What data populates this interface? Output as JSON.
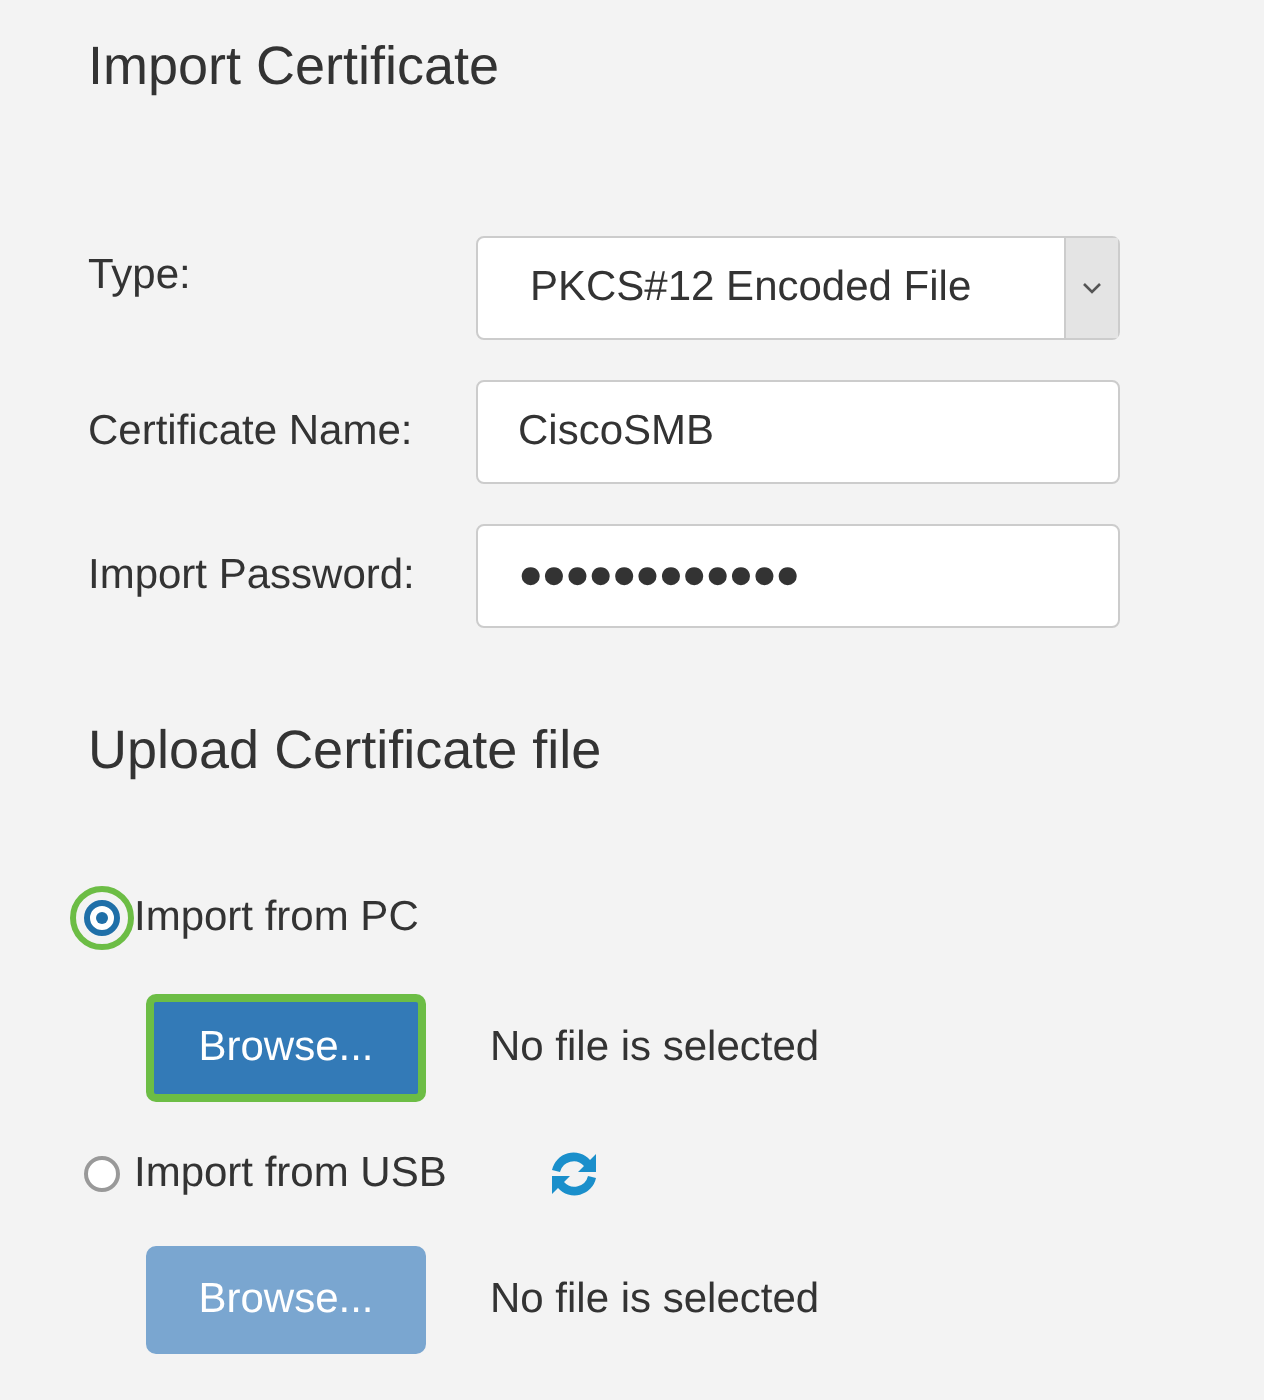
{
  "title": "Import Certificate",
  "form": [
    {
      "kind": "select",
      "label": "Type:",
      "value": "PKCS#12 Encoded File"
    },
    {
      "kind": "text",
      "label": "Certificate Name:",
      "value": "CiscoSMB"
    },
    {
      "kind": "text",
      "label": "Import Password:",
      "value": "●●●●●●●●●●●●"
    }
  ],
  "upload": {
    "title": "Upload Certificate file",
    "sources": [
      {
        "label": "Import from PC",
        "selected": true,
        "highlighted": true,
        "refresh": false,
        "button": {
          "label": "Browse...",
          "disabled": false,
          "highlighted": true
        },
        "file_status": "No file is selected"
      },
      {
        "label": "Import from USB",
        "selected": false,
        "highlighted": false,
        "refresh": true,
        "button": {
          "label": "Browse...",
          "disabled": true,
          "highlighted": false
        },
        "file_status": "No file is selected"
      }
    ]
  }
}
